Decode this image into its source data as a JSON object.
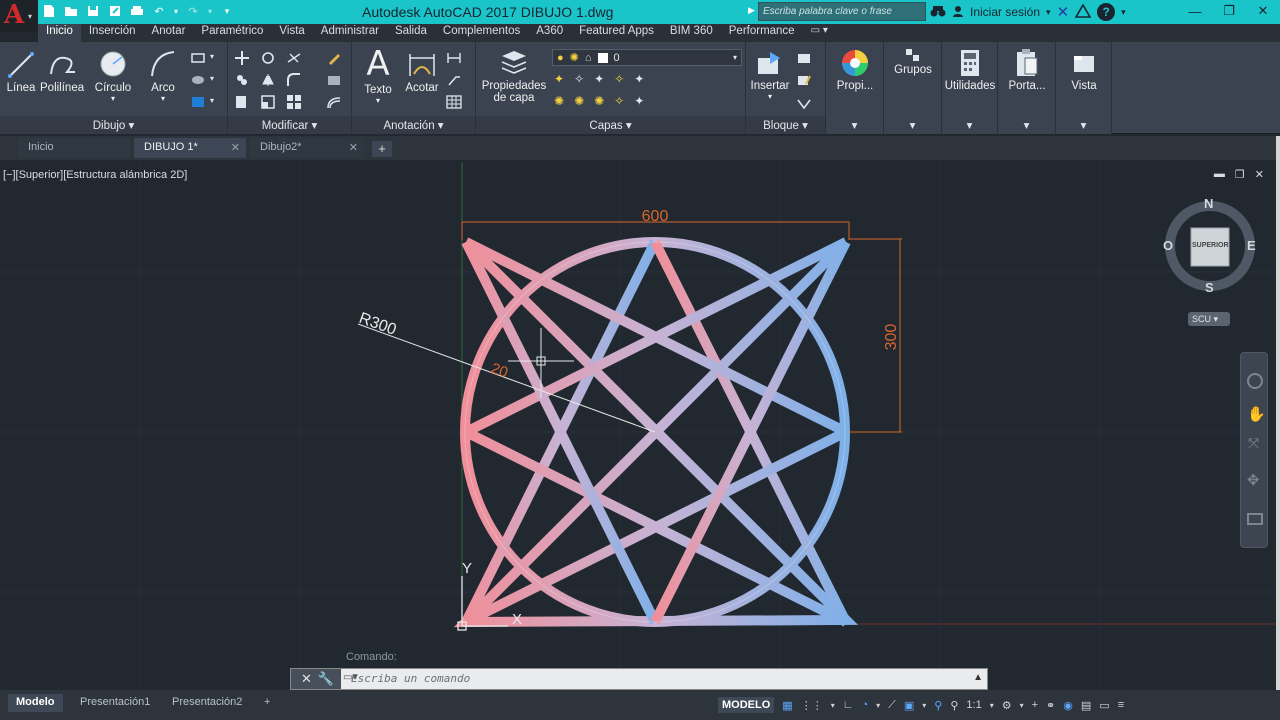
{
  "app": {
    "title": "Autodesk AutoCAD 2017    DIBUJO 1.dwg",
    "search_placeholder": "Escriba palabra clave o frase",
    "signin_label": "Iniciar sesión",
    "help_label": "?"
  },
  "ribbon_tabs": [
    "Inicio",
    "Inserción",
    "Anotar",
    "Paramétrico",
    "Vista",
    "Administrar",
    "Salida",
    "Complementos",
    "A360",
    "Featured Apps",
    "BIM 360",
    "Performance"
  ],
  "panels": {
    "dibujo": {
      "label": "Dibujo",
      "tools": [
        "Línea",
        "Polilínea",
        "Círculo",
        "Arco"
      ]
    },
    "modificar": {
      "label": "Modificar"
    },
    "anotacion": {
      "label": "Anotación",
      "tools": [
        "Texto",
        "Acotar"
      ]
    },
    "capas": {
      "label": "Capas",
      "prop_label_1": "Propiedades",
      "prop_label_2": "de capa",
      "layer_value": "0"
    },
    "bloque": {
      "label": "Bloque",
      "tool": "Insertar"
    },
    "extra_tools": [
      "Propi...",
      "Grupos",
      "Utilidades",
      "Porta...",
      "Vista"
    ]
  },
  "doc_tabs": [
    "Inicio",
    "DIBUJO 1*",
    "Dibujo2*"
  ],
  "viewport": {
    "label": "[−][Superior][Estructura alámbrica 2D]",
    "dim_width": "600",
    "dim_height": "300",
    "dim_radius": "R300",
    "dim_offset": "20",
    "axis_y": "Y",
    "axis_x": "X"
  },
  "viewcube": {
    "north": "N",
    "south": "S",
    "east": "E",
    "west": "O",
    "face": "SUPERIOR",
    "ucs": "SCU"
  },
  "command": {
    "label": "Comando:",
    "placeholder": "Escriba un comando"
  },
  "status": {
    "layout_tabs": [
      "Modelo",
      "Presentación1",
      "Presentación2"
    ],
    "mode": "MODELO",
    "scale": "1:1"
  },
  "colors": {
    "titlebar": "#19c5c9",
    "ribbon": "#3b4350",
    "canvas": "#212830",
    "dimension": "#d9662c",
    "star_left": "#f08f9a",
    "star_right": "#7fb0e8"
  }
}
